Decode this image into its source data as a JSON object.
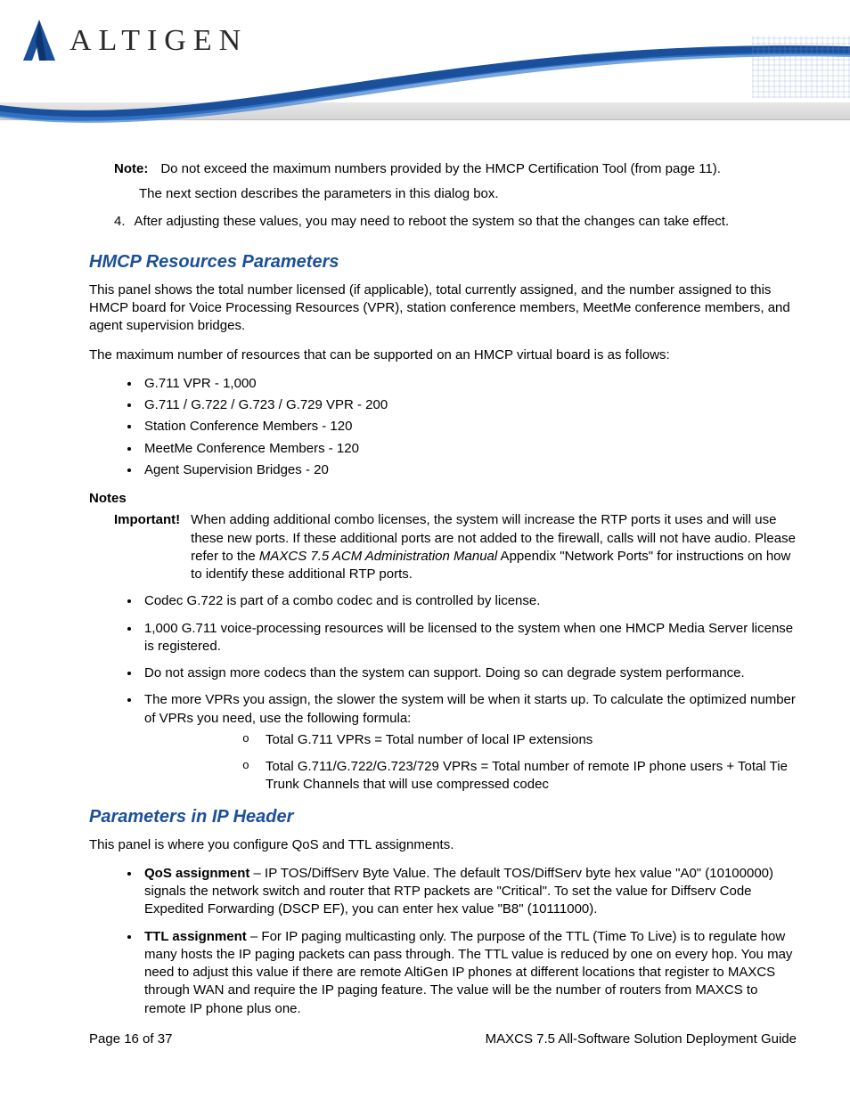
{
  "brand": "ALTIGEN",
  "note": {
    "label": "Note:",
    "line1": "Do not exceed the maximum numbers provided by the HMCP Certification Tool (from page 11).",
    "line2": "The next section describes the parameters in this dialog box."
  },
  "step4": {
    "num": "4.",
    "text": "After adjusting these values, you may need to reboot the system so that the changes can take effect."
  },
  "section1": {
    "title": "HMCP Resources Parameters",
    "p1": "This panel shows the total number licensed (if applicable), total currently assigned, and the number assigned to this HMCP board for Voice Processing Resources (VPR), station conference members, MeetMe conference members, and agent supervision bridges.",
    "p2": "The maximum number of resources that can be supported on an HMCP virtual board is as follows:",
    "bullets": [
      "G.711 VPR - 1,000",
      "G.711 / G.722 / G.723 / G.729 VPR - 200",
      "Station Conference Members - 120",
      "MeetMe Conference Members - 120",
      "Agent Supervision Bridges - 20"
    ]
  },
  "notes": {
    "heading": "Notes",
    "important_label": "Important!",
    "important_prefix": "When adding additional combo licenses, the system will increase the RTP ports it uses and will use these new ports. If these additional ports are not added to the firewall, calls will not have audio. Please refer to the ",
    "important_ital": "MAXCS 7.5 ACM Administration Manual",
    "important_suffix": " Appendix \"Network Ports\" for instructions on how to identify these additional RTP ports.",
    "bullets": {
      "b1": "Codec G.722 is part of a combo codec and is controlled by license.",
      "b2": "1,000 G.711 voice-processing resources will be licensed to the system when one HMCP Media Server license is registered.",
      "b3": "Do not assign more codecs than the system can support. Doing so can degrade system performance.",
      "b4": "The more VPRs you assign, the slower the system will be when it starts up. To calculate the optimized number of VPRs you need, use the following formula:"
    },
    "formulas": {
      "f1": "Total G.711 VPRs = Total number of local IP extensions",
      "f2": "Total G.711/G.722/G.723/729 VPRs = Total number of remote IP phone users + Total Tie Trunk Channels that will use compressed codec"
    }
  },
  "section2": {
    "title": "Parameters in IP Header",
    "p1": "This panel is where you configure QoS and TTL assignments.",
    "qos_label": "QoS assignment",
    "qos_text": " – IP TOS/DiffServ Byte Value. The default TOS/DiffServ byte hex value \"A0\" (10100000) signals the network switch and router that RTP packets are \"Critical\". To set the value for Diffserv Code Expedited Forwarding (DSCP EF), you can enter hex value \"B8\" (10111000).",
    "ttl_label": "TTL assignment",
    "ttl_text": " – For IP paging multicasting only. The purpose of the TTL (Time To Live) is to regulate how many hosts the IP paging packets can pass through. The TTL value is reduced by one on every hop. You may need to adjust this value if there are remote AltiGen IP phones at different locations that register to MAXCS through WAN and require the IP paging feature. The value will be the number of routers from MAXCS to remote IP phone plus one."
  },
  "footer": {
    "left": "Page 16 of 37",
    "right": "MAXCS 7.5 All-Software Solution Deployment Guide"
  }
}
